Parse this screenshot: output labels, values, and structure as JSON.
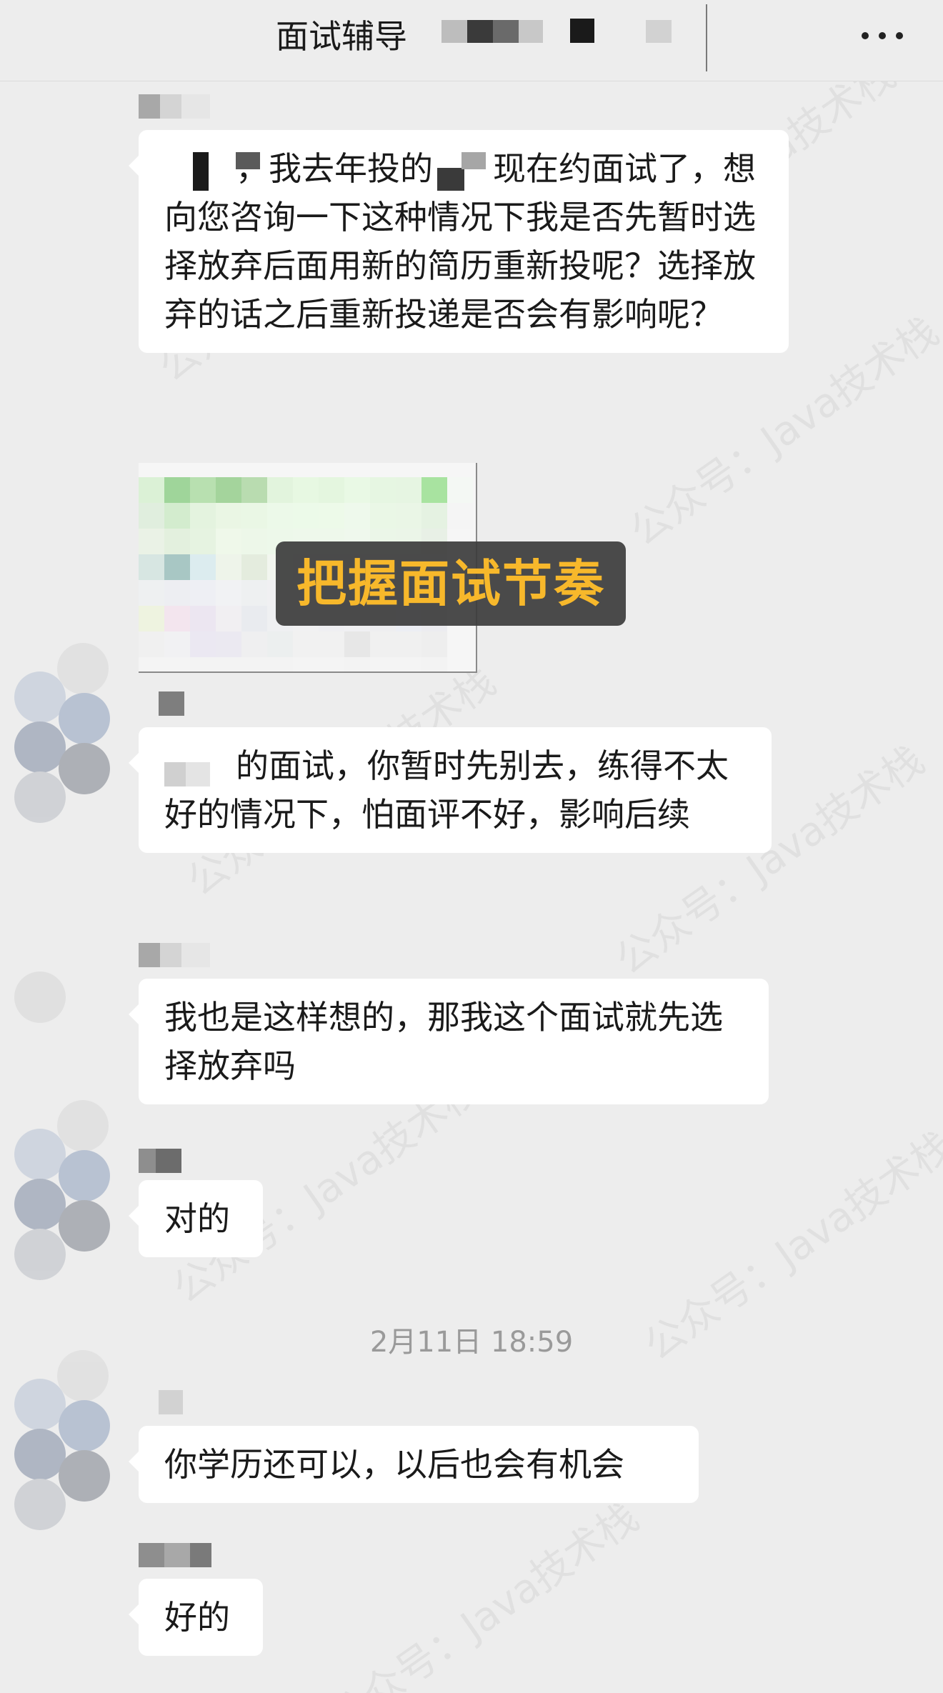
{
  "header": {
    "title": "面试辅导",
    "more_icon": "more-horizontal-icon"
  },
  "messages": [
    {
      "type": "text",
      "segments_before": "，我去年投的",
      "segments_after": "现在约面试了，想向您咨询一下这种情况下我是否先暂时选择放弃后面用新的简历重新投呢？选择放弃的话之后重新投递是否会有影响呢？"
    },
    {
      "type": "image",
      "caption": "把握面试节奏"
    },
    {
      "type": "text",
      "text_after_redact": "的面试，你暂时先别去，练得不太好的情况下，怕面评不好，影响后续"
    },
    {
      "type": "text",
      "text": "我也是这样想的，那我这个面试就先选择放弃吗"
    },
    {
      "type": "text",
      "text": "对的"
    },
    {
      "type": "text",
      "text": "你学历还可以，以后也会有机会"
    },
    {
      "type": "text",
      "text": "好的"
    }
  ],
  "timestamp": "2月11日 18:59",
  "watermark": "公众号：Java技术栈",
  "colors": {
    "background": "#ededed",
    "bubble": "#ffffff",
    "caption_text": "#f7b82b",
    "caption_bg": "#3c3c3c",
    "timestamp": "#9a9a9a"
  }
}
